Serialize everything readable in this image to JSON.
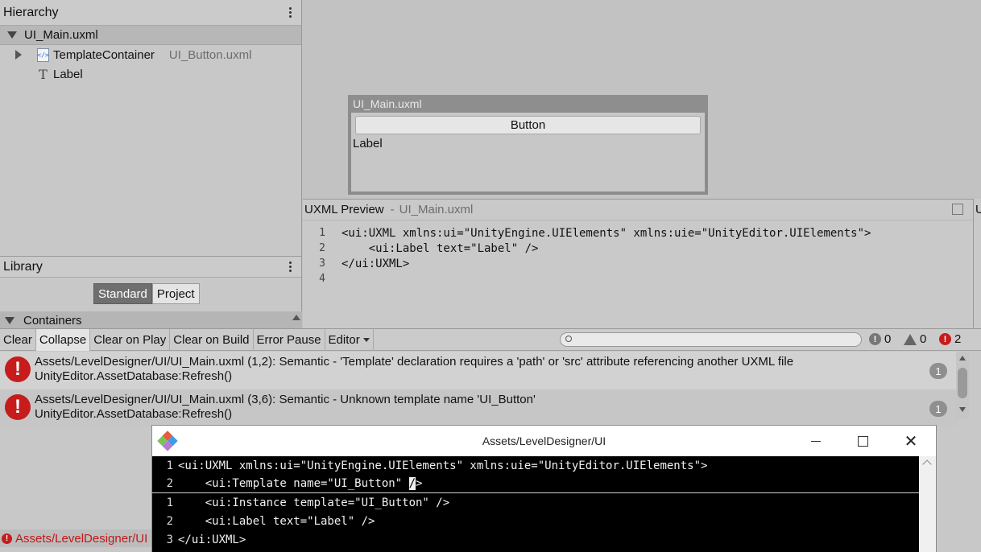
{
  "hierarchy": {
    "title": "Hierarchy",
    "document": "UI_Main.uxml",
    "items": [
      {
        "label": "TemplateContainer",
        "source": "UI_Button.uxml"
      },
      {
        "label": "Label"
      }
    ]
  },
  "library": {
    "title": "Library",
    "tabs": [
      "Standard",
      "Project"
    ],
    "section": "Containers"
  },
  "canvas": {
    "title": "UI_Main.uxml",
    "button": "Button",
    "label": "Label"
  },
  "preview": {
    "title": "UXML Preview",
    "separator": "-",
    "file": "UI_Main.uxml",
    "right_tab": "U",
    "line_numbers": [
      "1",
      "2",
      "3",
      "4"
    ],
    "lines": [
      "<ui:UXML xmlns:ui=\"UnityEngine.UIElements\" xmlns:uie=\"UnityEditor.UIElements\">",
      "    <ui:Label text=\"Label\" />",
      "</ui:UXML>",
      ""
    ]
  },
  "console": {
    "toolbar": [
      "Clear",
      "Collapse",
      "Clear on Play",
      "Clear on Build",
      "Error Pause",
      "Editor"
    ],
    "counts": {
      "info": "0",
      "warning": "0",
      "error": "2"
    },
    "logs": [
      {
        "line1": "Assets/LevelDesigner/UI/UI_Main.uxml (1,2): Semantic - 'Template' declaration requires a 'path' or 'src' attribute referencing another UXML file",
        "line2": "UnityEditor.AssetDatabase:Refresh()",
        "count": "1"
      },
      {
        "line1": "Assets/LevelDesigner/UI/UI_Main.uxml (3,6): Semantic - Unknown template name 'UI_Button'",
        "line2": "UnityEditor.AssetDatabase:Refresh()",
        "count": "1"
      }
    ],
    "status": "Assets/LevelDesigner/UI"
  },
  "editor": {
    "title": "Assets/LevelDesigner/UI",
    "line_numbers": [
      "1",
      "2",
      "1",
      "2",
      "3"
    ],
    "lines": [
      "<ui:UXML xmlns:ui=\"UnityEngine.UIElements\" xmlns:uie=\"UnityEditor.UIElements\">",
      "    <ui:Template name=\"UI_Button\" ",
      "    <ui:Instance template=\"UI_Button\" />",
      "    <ui:Label text=\"Label\" />",
      "</ui:UXML>"
    ],
    "cursor_char": "/",
    "after_cursor": ">"
  },
  "colors": {
    "error": "#c71c1c",
    "panel": "#c8c8c8",
    "code_bg": "#000000"
  }
}
